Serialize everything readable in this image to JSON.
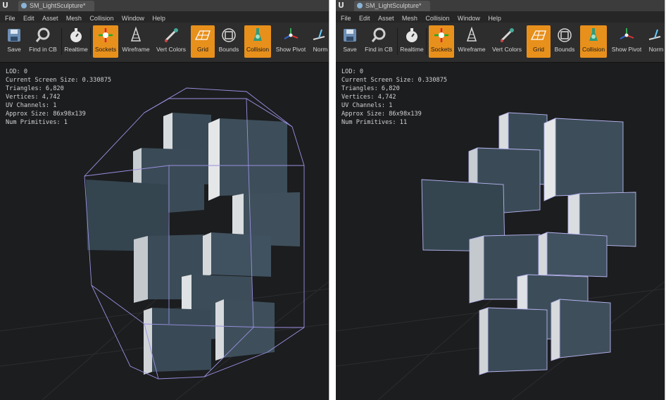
{
  "window": {
    "tab_title": "SM_LightSculpture*",
    "logo": "U"
  },
  "menu": [
    "File",
    "Edit",
    "Asset",
    "Mesh",
    "Collision",
    "Window",
    "Help"
  ],
  "toolbar": [
    {
      "label": "Save",
      "icon": "save-icon",
      "active": false
    },
    {
      "label": "Find in CB",
      "icon": "magnifier-icon",
      "active": false
    },
    {
      "label": "Realtime",
      "icon": "stopwatch-icon",
      "active": false
    },
    {
      "label": "Sockets",
      "icon": "sockets-icon",
      "active": true
    },
    {
      "label": "Wireframe",
      "icon": "wireframe-icon",
      "active": false
    },
    {
      "label": "Vert Colors",
      "icon": "vert-colors-icon",
      "active": false
    },
    {
      "label": "Grid",
      "icon": "grid-icon",
      "active": true
    },
    {
      "label": "Bounds",
      "icon": "bounds-icon",
      "active": false
    },
    {
      "label": "Collision",
      "icon": "collision-icon",
      "active": true
    },
    {
      "label": "Show Pivot",
      "icon": "pivot-icon",
      "active": false
    },
    {
      "label": "Norm",
      "icon": "normals-icon",
      "active": false
    }
  ],
  "panels": [
    {
      "stats": {
        "lod": "LOD:  0",
        "screen_size": "Current Screen Size:  0.330875",
        "triangles": "Triangles:  6,820",
        "vertices": "Vertices:  4,742",
        "uv_channels": "UV Channels:  1",
        "approx_size": "Approx Size: 86x98x139",
        "num_primitives": "Num Primitives:  1"
      }
    },
    {
      "stats": {
        "lod": "LOD:  0",
        "screen_size": "Current Screen Size:  0.330875",
        "triangles": "Triangles:  6,820",
        "vertices": "Vertices:  4,742",
        "uv_channels": "UV Channels:  1",
        "approx_size": "Approx Size: 86x98x139",
        "num_primitives": "Num Primitives:  11"
      }
    }
  ],
  "colors": {
    "orange_active": "#e8901c",
    "collision_line": "#9b8fe0",
    "viewport_bg": "#1c1d1f"
  }
}
